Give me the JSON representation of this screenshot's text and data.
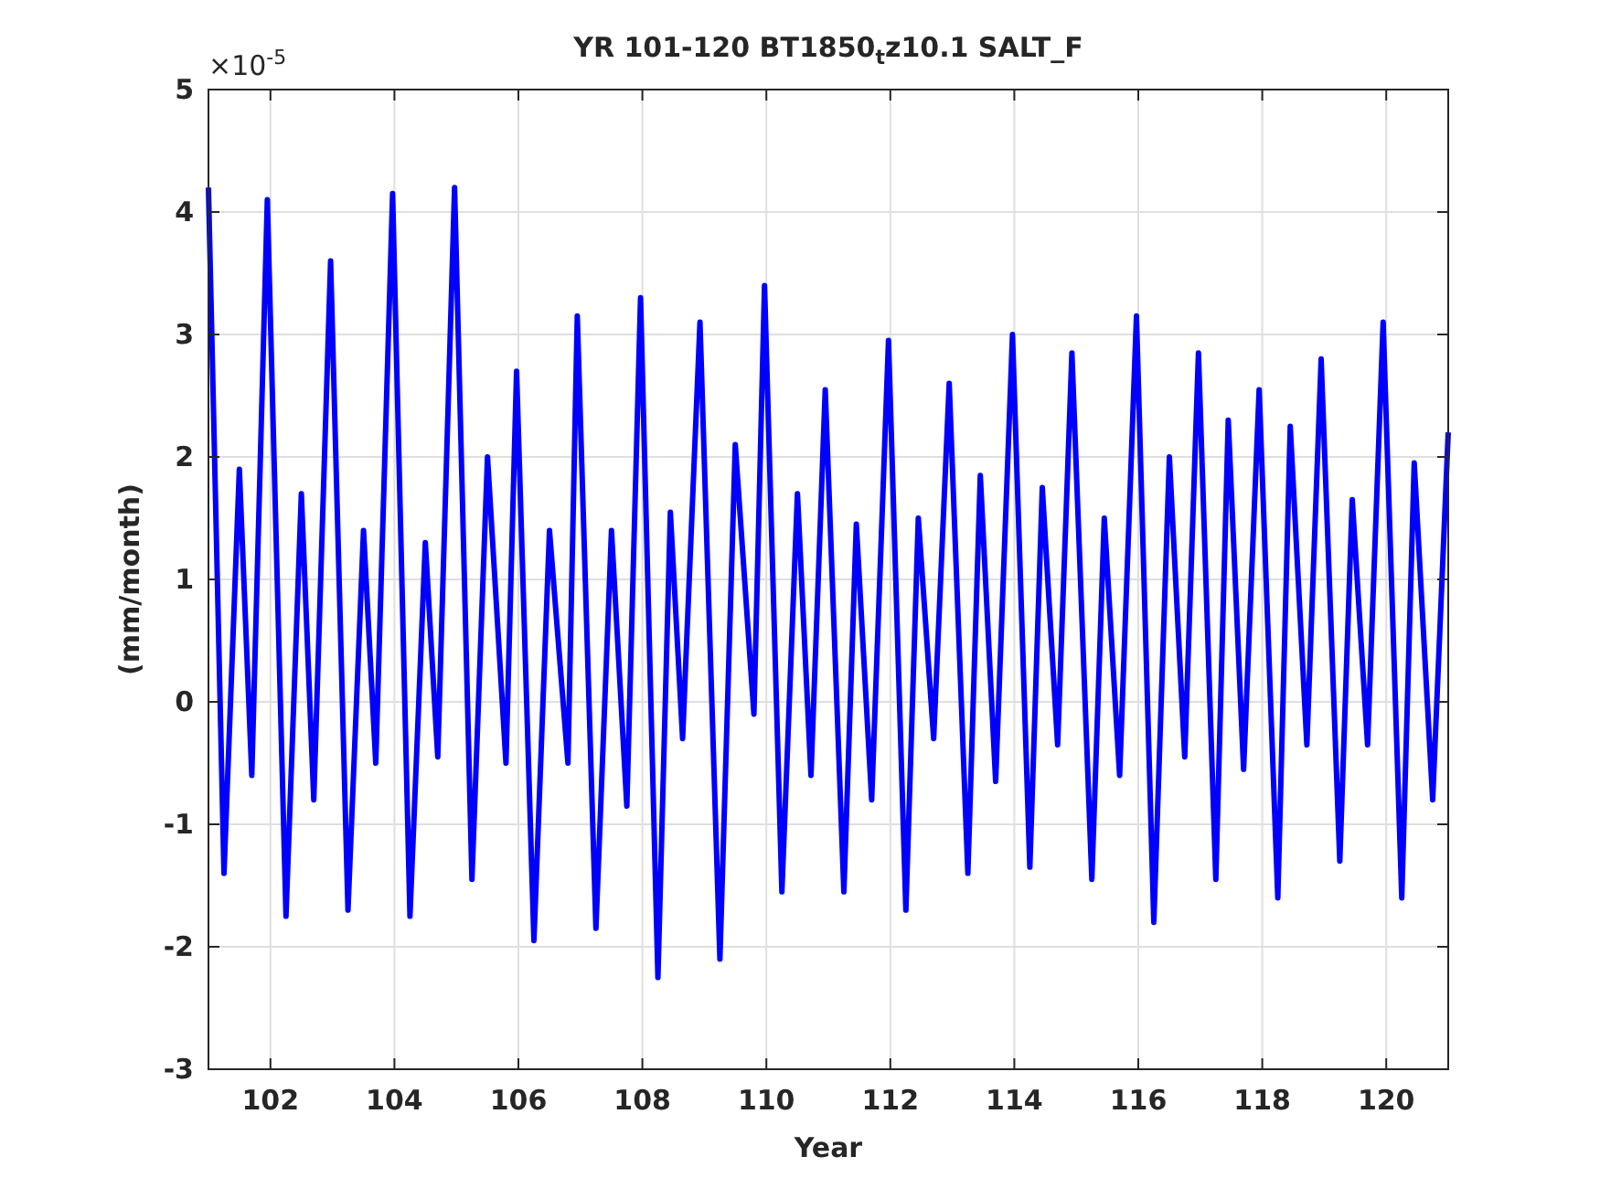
{
  "figure": {
    "exponent_label": "×10$^{-5}$",
    "chart_data": {
      "type": "line",
      "title": "YR 101-120 BT1850$_{t}$z10.1 SALT_F",
      "xlabel": "Year",
      "ylabel": "(mm/month)",
      "x": [
        101.0,
        101.25,
        101.5,
        101.7,
        101.95,
        102.25,
        102.5,
        102.7,
        102.97,
        103.25,
        103.5,
        103.7,
        103.97,
        104.25,
        104.5,
        104.7,
        104.97,
        105.25,
        105.5,
        105.8,
        105.97,
        106.25,
        106.5,
        106.8,
        106.95,
        107.25,
        107.5,
        107.75,
        107.97,
        108.25,
        108.45,
        108.65,
        108.93,
        109.25,
        109.5,
        109.8,
        109.97,
        110.25,
        110.5,
        110.72,
        110.95,
        111.25,
        111.45,
        111.7,
        111.97,
        112.25,
        112.45,
        112.7,
        112.95,
        113.25,
        113.45,
        113.7,
        113.97,
        114.25,
        114.45,
        114.7,
        114.93,
        115.25,
        115.45,
        115.7,
        115.97,
        116.25,
        116.5,
        116.75,
        116.97,
        117.25,
        117.45,
        117.7,
        117.95,
        118.25,
        118.45,
        118.72,
        118.95,
        119.25,
        119.45,
        119.7,
        119.95,
        120.25,
        120.45,
        120.75,
        121.0
      ],
      "series": [
        {
          "color": "#0000ff",
          "values": [
            4.2,
            -1.4,
            1.9,
            -0.6,
            4.1,
            -1.75,
            1.7,
            -0.8,
            3.6,
            -1.7,
            1.4,
            -0.5,
            4.15,
            -1.75,
            1.3,
            -0.45,
            4.2,
            -1.45,
            2.0,
            -0.5,
            2.7,
            -1.95,
            1.4,
            -0.5,
            3.15,
            -1.85,
            1.4,
            -0.85,
            3.3,
            -2.25,
            1.55,
            -0.3,
            3.1,
            -2.1,
            2.1,
            -0.1,
            3.4,
            -1.55,
            1.7,
            -0.6,
            2.55,
            -1.55,
            1.45,
            -0.8,
            2.95,
            -1.7,
            1.5,
            -0.3,
            2.6,
            -1.4,
            1.85,
            -0.65,
            3.0,
            -1.35,
            1.75,
            -0.35,
            2.85,
            -1.45,
            1.5,
            -0.6,
            3.15,
            -1.8,
            2.0,
            -0.45,
            2.85,
            -1.45,
            2.3,
            -0.55,
            2.55,
            -1.6,
            2.25,
            -0.35,
            2.8,
            -1.3,
            1.65,
            -0.35,
            3.1,
            -1.6,
            1.95,
            -0.8,
            2.2
          ]
        }
      ],
      "grid": true,
      "xlim": [
        101,
        121
      ],
      "ylim": [
        -3,
        5
      ],
      "xticks": [
        102,
        104,
        106,
        108,
        110,
        112,
        114,
        116,
        118,
        120
      ],
      "yticks": [
        -3,
        -2,
        -1,
        0,
        1,
        2,
        3,
        4,
        5
      ]
    }
  }
}
